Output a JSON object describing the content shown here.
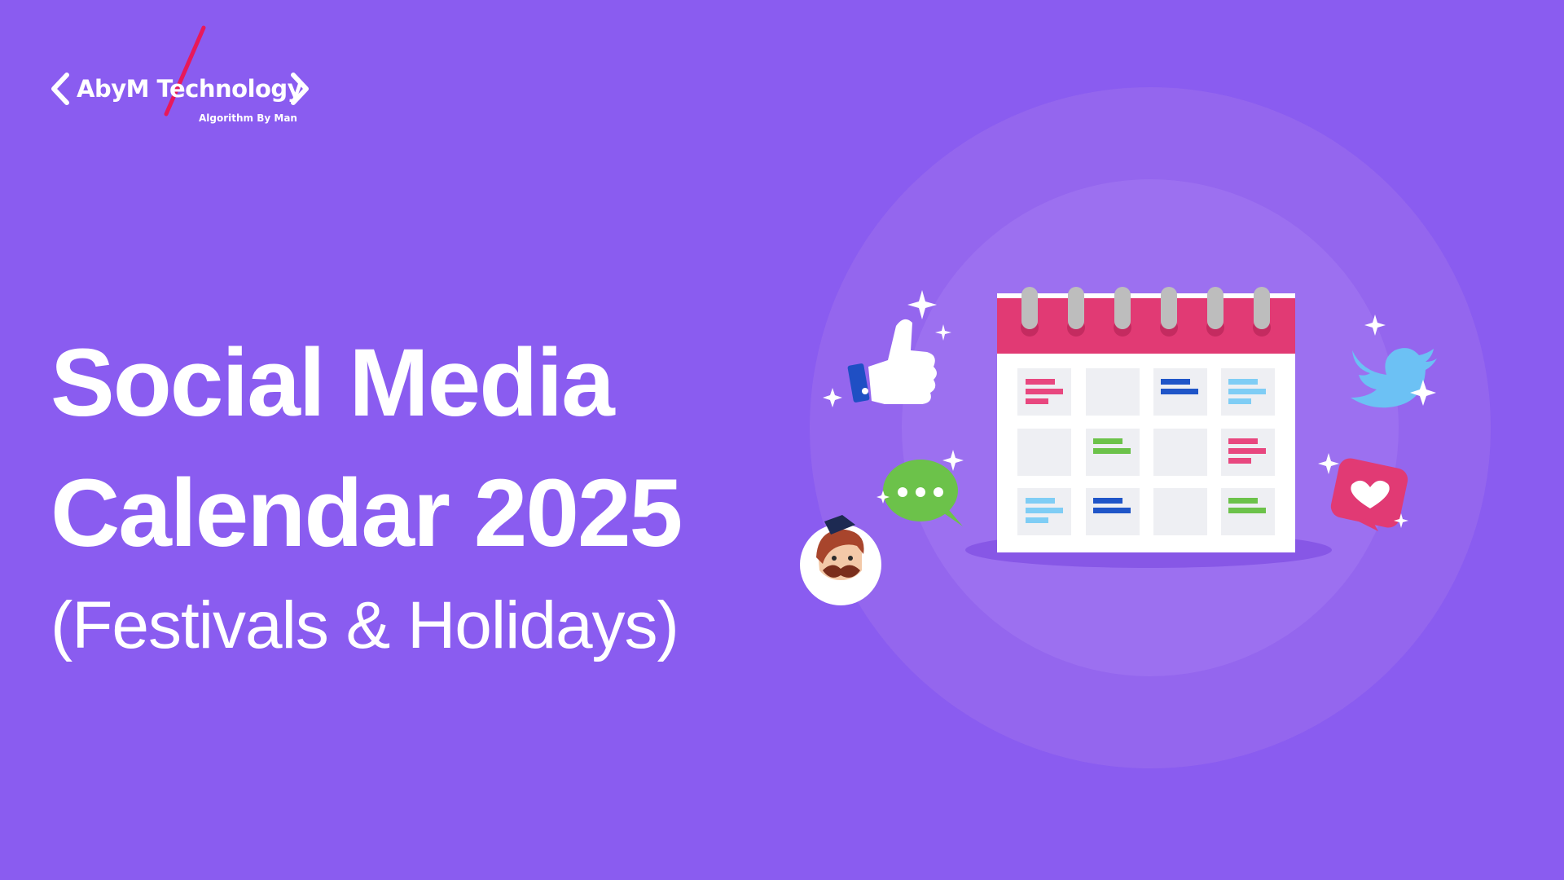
{
  "brand": {
    "name": "AbyM Technology",
    "tagline": "Algorithm By Man"
  },
  "headline": {
    "line1": "Social Media",
    "line2": "Calendar 2025",
    "subtitle": "(Festivals & Holidays)"
  },
  "colors": {
    "background": "#8a5cf0",
    "calendar_header": "#e13a74",
    "logo_slash": "#e8195a"
  },
  "icons": [
    "thumbs-up-icon",
    "chat-bubble-icon",
    "avatar-icon",
    "calendar-icon",
    "twitter-bird-icon",
    "heart-notification-icon",
    "sparkle-icon"
  ]
}
